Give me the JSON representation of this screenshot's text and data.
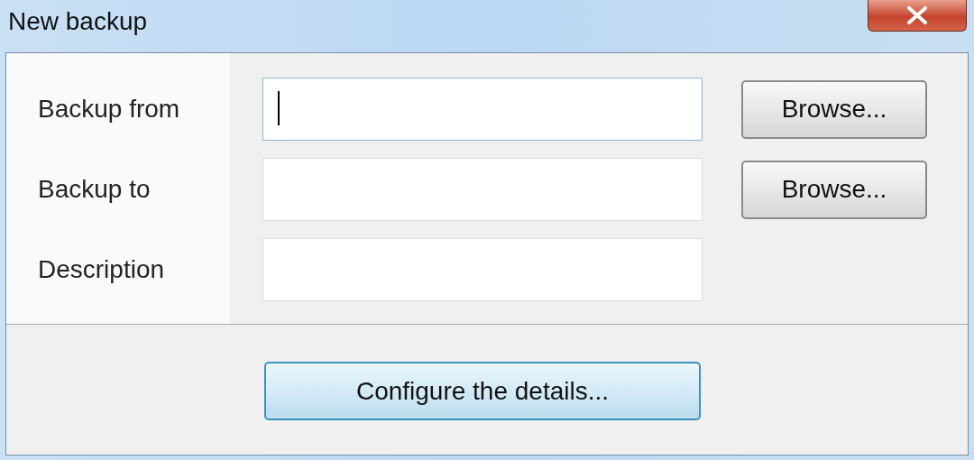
{
  "window": {
    "title": "New backup"
  },
  "rows": [
    {
      "label": "Backup from",
      "value": "",
      "focused": true,
      "button": "Browse..."
    },
    {
      "label": "Backup to",
      "value": "",
      "focused": false,
      "button": "Browse..."
    },
    {
      "label": "Description",
      "value": "",
      "focused": false
    }
  ],
  "footer_button": "Configure the details..."
}
